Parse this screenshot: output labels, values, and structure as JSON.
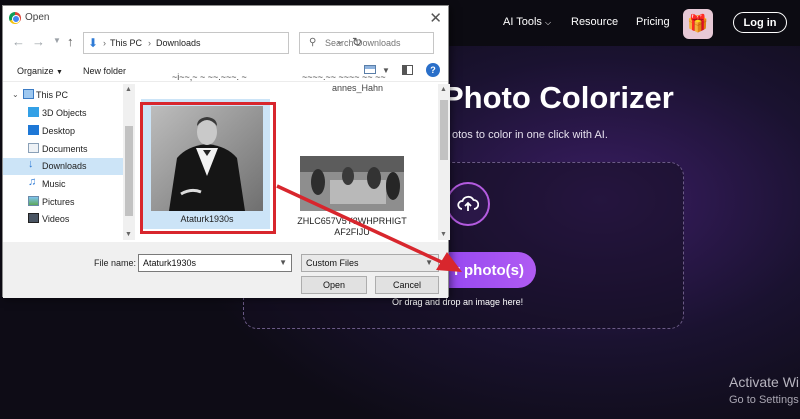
{
  "site": {
    "nav": {
      "ai_tools": "AI Tools",
      "resource": "Resource",
      "pricing": "Pricing",
      "login": "Log in"
    },
    "hero_title": "Photo Colorizer",
    "hero_subtitle": "otos to color in one click with AI.",
    "upload_button": "r photo(s)",
    "drag_text": "Or drag and drop an image here!",
    "activate_title": "Activate Wi",
    "activate_sub": "Go to Settings"
  },
  "dialog": {
    "title": "Open",
    "address": {
      "crumbs": [
        "This PC",
        "Downloads"
      ]
    },
    "search_placeholder": "Search Downloads",
    "organize": "Organize",
    "new_folder": "New folder",
    "help": "?",
    "tree": [
      {
        "label": "This PC",
        "icon": "pc-icon",
        "selected": false
      },
      {
        "label": "3D Objects",
        "icon": "cube-icon",
        "selected": false
      },
      {
        "label": "Desktop",
        "icon": "desktop-icon",
        "selected": false
      },
      {
        "label": "Documents",
        "icon": "documents-icon",
        "selected": false
      },
      {
        "label": "Downloads",
        "icon": "download-icon",
        "selected": true
      },
      {
        "label": "Music",
        "icon": "music-icon",
        "selected": false
      },
      {
        "label": "Pictures",
        "icon": "pictures-icon",
        "selected": false
      },
      {
        "label": "Videos",
        "icon": "videos-icon",
        "selected": false
      }
    ],
    "files": {
      "cut_label_1": "~i~~,~ ~ ~~.~~~. ~",
      "cut_label_2": "~~~~.~~ ~~~~ ~~ ~~",
      "cut_label_2b": "annes_Hahn",
      "file1": "Ataturk1930s",
      "file2": "ZHLC657V5Y3WHPRHIGTAF2FIJU"
    },
    "file_name_label": "File name:",
    "file_name_value": "Ataturk1930s",
    "file_type": "Custom Files",
    "open_button": "Open",
    "cancel_button": "Cancel"
  },
  "colors": {
    "accent_red": "#d8262d",
    "purple": "#8a3ff0",
    "selection": "#cce4f7"
  }
}
